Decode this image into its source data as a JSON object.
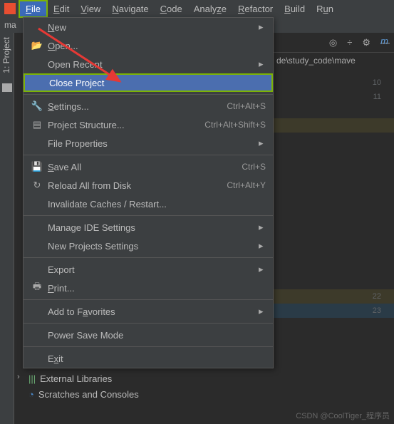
{
  "menubar": {
    "items": [
      {
        "label": "File",
        "ul": "F",
        "rest": "ile"
      },
      {
        "label": "Edit",
        "ul": "E",
        "rest": "dit"
      },
      {
        "label": "View",
        "ul": "V",
        "rest": "iew"
      },
      {
        "label": "Navigate",
        "ul": "N",
        "rest": "avigate"
      },
      {
        "label": "Code",
        "ul": "C",
        "rest": "ode"
      },
      {
        "label": "Analyze",
        "pre": "Analy",
        "ul": "z",
        "rest": "e"
      },
      {
        "label": "Refactor",
        "ul": "R",
        "rest": "efactor"
      },
      {
        "label": "Build",
        "ul": "B",
        "rest": "uild"
      },
      {
        "label": "Run",
        "pre": "R",
        "ul": "u",
        "rest": "n"
      }
    ]
  },
  "topstrip_breadcrumb": "ma",
  "sidebar": {
    "label": "1: Project"
  },
  "menu": {
    "new": "New",
    "open": "Open...",
    "open_recent": "Open Recent",
    "close_project": "Close Project",
    "settings": "Settings...",
    "settings_sc": "Ctrl+Alt+S",
    "proj_struct": "Project Structure...",
    "proj_struct_sc": "Ctrl+Alt+Shift+S",
    "file_props": "File Properties",
    "save_all": "Save All",
    "save_all_sc": "Ctrl+S",
    "reload": "Reload All from Disk",
    "reload_sc": "Ctrl+Alt+Y",
    "invalidate": "Invalidate Caches / Restart...",
    "manage_ide": "Manage IDE Settings",
    "new_proj_settings": "New Projects Settings",
    "export": "Export",
    "print": "Print...",
    "favorites": "Add to Favorites",
    "power_save": "Power Save Mode",
    "exit": "Exit"
  },
  "right": {
    "tab": "m",
    "breadcrumb": "de\\study_code\\mave"
  },
  "gutter": [
    "10",
    "11",
    "",
    "",
    "",
    "",
    "",
    "",
    "",
    "",
    "",
    "",
    "",
    "",
    "",
    "22",
    "23"
  ],
  "bottom": {
    "ext_lib": "External Libraries",
    "scratches": "Scratches and Consoles"
  },
  "watermark": "CSDN @CoolTiger_程序员"
}
